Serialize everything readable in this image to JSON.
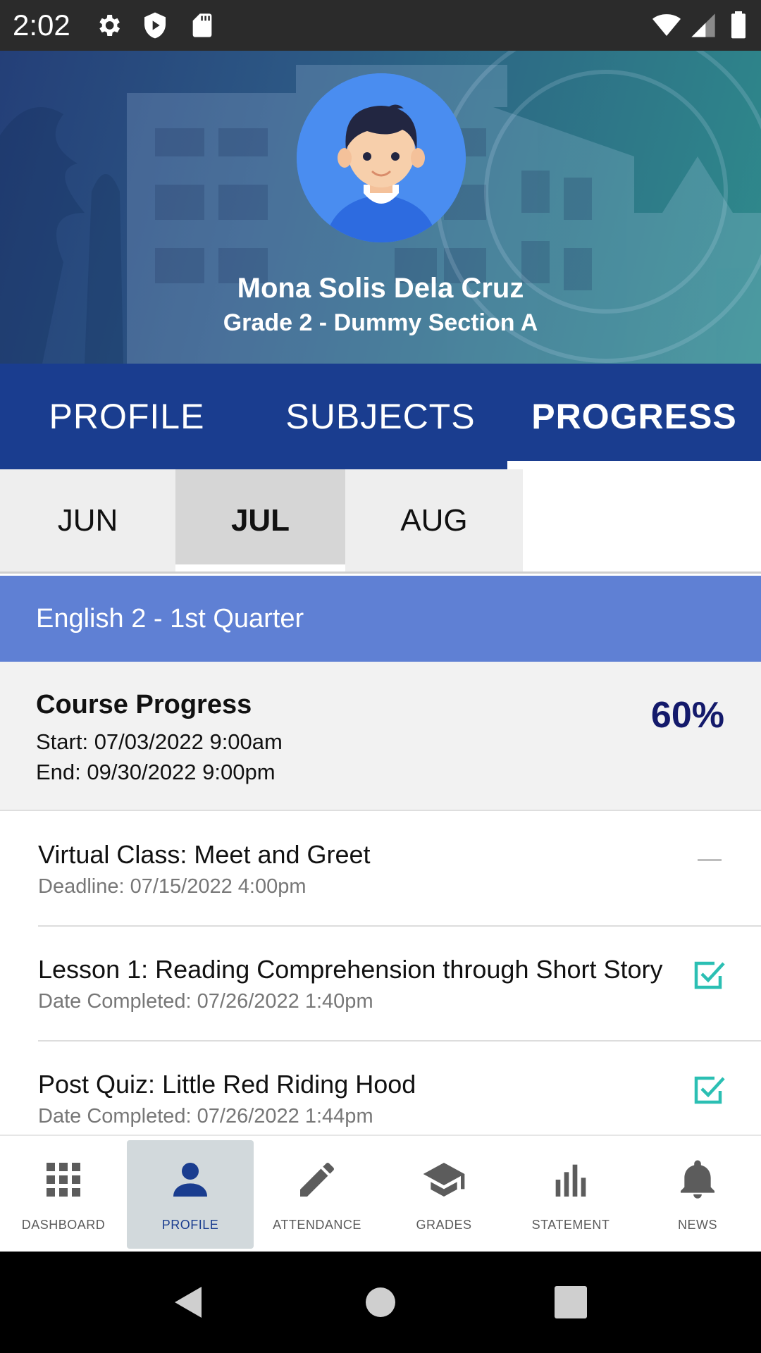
{
  "status_bar": {
    "time": "2:02",
    "left_icons": [
      "gear-icon",
      "shield-play-icon",
      "sd-card-icon"
    ],
    "right_icons": [
      "wifi-icon",
      "signal-icon",
      "battery-icon"
    ]
  },
  "header": {
    "student_name": "Mona Solis Dela Cruz",
    "student_section": "Grade 2 - Dummy Section A"
  },
  "tabs": [
    {
      "label": "PROFILE",
      "active": false
    },
    {
      "label": "SUBJECTS",
      "active": false
    },
    {
      "label": "PROGRESS",
      "active": true
    }
  ],
  "months": [
    {
      "label": "JUN",
      "active": false
    },
    {
      "label": "JUL",
      "active": true
    },
    {
      "label": "AUG",
      "active": false
    }
  ],
  "course": {
    "title": "English 2 - 1st Quarter",
    "progress_title": "Course Progress",
    "start": "Start: 07/03/2022 9:00am",
    "end": "End: 09/30/2022 9:00pm",
    "percent": "60%"
  },
  "tasks": [
    {
      "title": "Virtual Class: Meet and Greet",
      "subtitle": "Deadline: 07/15/2022 4:00pm",
      "status": "pending"
    },
    {
      "title": "Lesson 1: Reading Comprehension through Short Story",
      "subtitle": "Date Completed: 07/26/2022 1:40pm",
      "status": "completed"
    },
    {
      "title": "Post Quiz: Little Red Riding Hood",
      "subtitle": "Date Completed: 07/26/2022 1:44pm",
      "status": "completed"
    }
  ],
  "bottom_nav": [
    {
      "label": "DASHBOARD",
      "icon": "grid-icon",
      "active": false
    },
    {
      "label": "PROFILE",
      "icon": "person-icon",
      "active": true
    },
    {
      "label": "ATTENDANCE",
      "icon": "pencil-icon",
      "active": false
    },
    {
      "label": "GRADES",
      "icon": "graduation-cap-icon",
      "active": false
    },
    {
      "label": "STATEMENT",
      "icon": "bar-chart-icon",
      "active": false
    },
    {
      "label": "NEWS",
      "icon": "bell-icon",
      "active": false
    }
  ],
  "colors": {
    "primary": "#1a3d8f",
    "course_header": "#5f80d4",
    "percent": "#141a6b",
    "check": "#2bbfb3",
    "avatar_bg": "#4a8df0"
  }
}
